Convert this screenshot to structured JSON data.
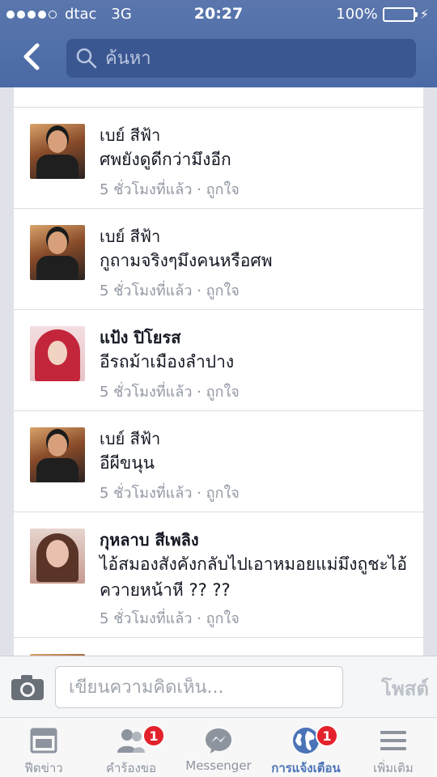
{
  "status_bar": {
    "carrier": "dtac",
    "network": "3G",
    "time": "20:27",
    "battery_percent": "100%",
    "battery_level": 1.0
  },
  "nav": {
    "back_icon": "chevron-left-icon",
    "search_placeholder": "ค้นหา"
  },
  "comments": [
    {
      "name": "เบย์ สีฟ้า",
      "name_bold": false,
      "text": "ศพยังดูดีกว่ามึงอีก",
      "time": "5 ชั่วโมงที่แล้ว",
      "separator": "·",
      "like": "ถูกใจ"
    },
    {
      "name": "เบย์ สีฟ้า",
      "name_bold": false,
      "text": "กูถามจริงๆมึงคนหรือศพ",
      "time": "5 ชั่วโมงที่แล้ว",
      "separator": "·",
      "like": "ถูกใจ"
    },
    {
      "name": "แป้ง ปิโยรส",
      "name_bold": true,
      "text": "อีรถม้าเมืองลำปาง",
      "time": "5 ชั่วโมงที่แล้ว",
      "separator": "·",
      "like": "ถูกใจ"
    },
    {
      "name": "เบย์ สีฟ้า",
      "name_bold": false,
      "text": "อีผีขนุน",
      "time": "5 ชั่วโมงที่แล้ว",
      "separator": "·",
      "like": "ถูกใจ"
    },
    {
      "name": "กุหลาบ สีเพลิง",
      "name_bold": true,
      "text": "ไอ้สมองสังคังกลับไปเอาหมอยแม่มึงถูชะไอ้ควายหน้าหี ?? ??",
      "time": "5 ชั่วโมงที่แล้ว",
      "separator": "·",
      "like": "ถูกใจ"
    }
  ],
  "composer": {
    "camera_icon": "camera-icon",
    "placeholder": "เขียนความคิดเห็น...",
    "post_label": "โพสต์"
  },
  "tabs": [
    {
      "label": "ฟีดข่าว",
      "icon": "news-feed-icon",
      "badge": ""
    },
    {
      "label": "คำร้องขอ",
      "icon": "friend-requests-icon",
      "badge": "1"
    },
    {
      "label": "Messenger",
      "icon": "messenger-icon",
      "badge": ""
    },
    {
      "label": "การแจ้งเตือน",
      "icon": "globe-icon",
      "badge": "1",
      "active": true
    },
    {
      "label": "เพิ่มเติม",
      "icon": "menu-icon",
      "badge": ""
    }
  ],
  "colors": {
    "header": "#4a6aa5",
    "accent": "#4b73b7",
    "badge": "#e3222b",
    "battery": "#5ad35c"
  }
}
